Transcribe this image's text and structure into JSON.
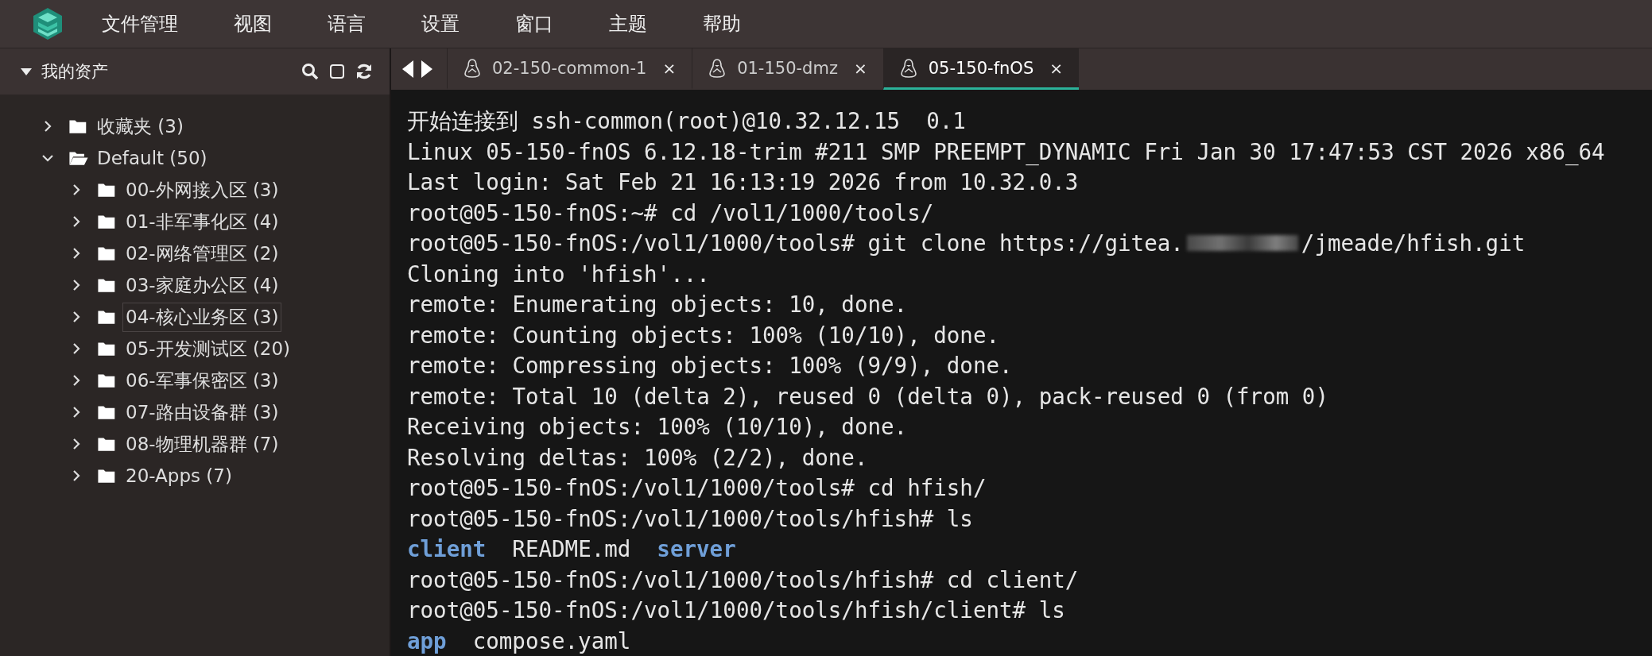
{
  "menu": [
    "文件管理",
    "视图",
    "语言",
    "设置",
    "窗口",
    "主题",
    "帮助"
  ],
  "sidebar": {
    "title": "我的资产",
    "expanded": true,
    "tree": [
      {
        "label": "收藏夹 (3)",
        "expanded": false,
        "hovered": false
      },
      {
        "label": "Default (50)",
        "expanded": true,
        "hovered": false,
        "children": [
          {
            "label": "00-外网接入区 (3)",
            "expanded": false,
            "hovered": false
          },
          {
            "label": "01-非军事化区 (4)",
            "expanded": false,
            "hovered": false
          },
          {
            "label": "02-网络管理区 (2)",
            "expanded": false,
            "hovered": false
          },
          {
            "label": "03-家庭办公区 (4)",
            "expanded": false,
            "hovered": false
          },
          {
            "label": "04-核心业务区 (3)",
            "expanded": false,
            "hovered": true
          },
          {
            "label": "05-开发测试区 (20)",
            "expanded": false,
            "hovered": false
          },
          {
            "label": "06-军事保密区 (3)",
            "expanded": false,
            "hovered": false
          },
          {
            "label": "07-路由设备群 (3)",
            "expanded": false,
            "hovered": false
          },
          {
            "label": "08-物理机器群 (7)",
            "expanded": false,
            "hovered": false
          },
          {
            "label": "20-Apps (7)",
            "expanded": false,
            "hovered": false
          }
        ]
      }
    ]
  },
  "tabs": [
    {
      "label": "02-150-common-1",
      "close": "×",
      "selected": false
    },
    {
      "label": "01-150-dmz",
      "close": "×",
      "selected": false
    },
    {
      "label": "05-150-fnOS",
      "close": "×",
      "selected": true
    }
  ],
  "terminal": [
    [
      {
        "kind": "text",
        "text": "开始连接到 ssh-common(root)@10.32.12.15  0.1"
      }
    ],
    [
      {
        "kind": "text",
        "text": "Linux 05-150-fnOS 6.12.18-trim #211 SMP PREEMPT_DYNAMIC Fri Jan 30 17:47:53 CST 2026 x86_64"
      }
    ],
    [
      {
        "kind": "text",
        "text": "Last login: Sat Feb 21 16:13:19 2026 from 10.32.0.3"
      }
    ],
    [
      {
        "kind": "text",
        "text": "root@05-150-fnOS:~# cd /vol1/1000/tools/"
      }
    ],
    [
      {
        "kind": "text",
        "text": "root@05-150-fnOS:/vol1/1000/tools# git clone https://gitea."
      },
      {
        "kind": "redacted"
      },
      {
        "kind": "text",
        "text": "/jmeade/hfish.git"
      }
    ],
    [
      {
        "kind": "text",
        "text": "Cloning into 'hfish'..."
      }
    ],
    [
      {
        "kind": "text",
        "text": "remote: Enumerating objects: 10, done."
      }
    ],
    [
      {
        "kind": "text",
        "text": "remote: Counting objects: 100% (10/10), done."
      }
    ],
    [
      {
        "kind": "text",
        "text": "remote: Compressing objects: 100% (9/9), done."
      }
    ],
    [
      {
        "kind": "text",
        "text": "remote: Total 10 (delta 2), reused 0 (delta 0), pack-reused 0 (from 0)"
      }
    ],
    [
      {
        "kind": "text",
        "text": "Receiving objects: 100% (10/10), done."
      }
    ],
    [
      {
        "kind": "text",
        "text": "Resolving deltas: 100% (2/2), done."
      }
    ],
    [
      {
        "kind": "text",
        "text": "root@05-150-fnOS:/vol1/1000/tools# cd hfish/"
      }
    ],
    [
      {
        "kind": "text",
        "text": "root@05-150-fnOS:/vol1/1000/tools/hfish# ls"
      }
    ],
    [
      {
        "kind": "dir",
        "text": "client"
      },
      {
        "kind": "text",
        "text": "README.md"
      },
      {
        "kind": "dir",
        "text": "server"
      }
    ],
    [
      {
        "kind": "text",
        "text": "root@05-150-fnOS:/vol1/1000/tools/hfish# cd client/"
      }
    ],
    [
      {
        "kind": "text",
        "text": "root@05-150-fnOS:/vol1/1000/tools/hfish/client# ls"
      }
    ],
    [
      {
        "kind": "dir",
        "text": "app"
      },
      {
        "kind": "text",
        "text": "compose.yaml"
      }
    ]
  ]
}
